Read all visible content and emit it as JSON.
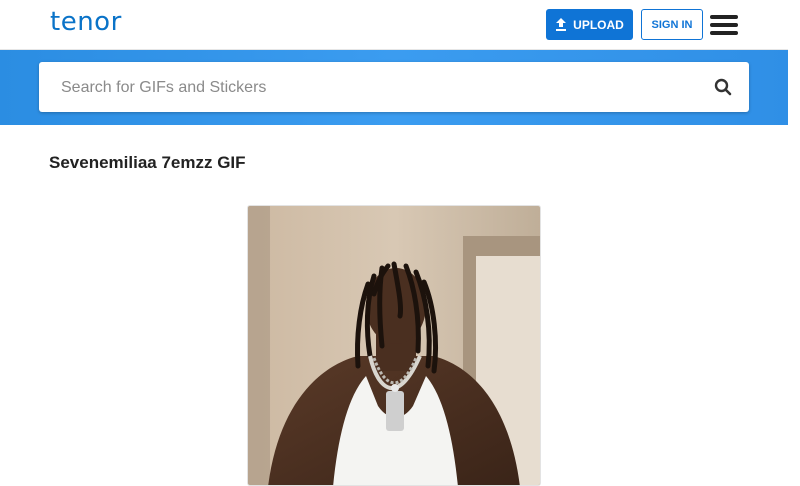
{
  "header": {
    "logo_text": "tenor",
    "upload_label": "UPLOAD",
    "signin_label": "SIGN IN",
    "menu_icon": "hamburger-menu-icon",
    "brand_color": "#0a73c8",
    "accent_color": "#0f74d6"
  },
  "search": {
    "placeholder": "Search for GIFs and Stickers",
    "value": "",
    "icon": "search-icon",
    "band_color": "#3b9cf0"
  },
  "main": {
    "title": "Sevenemiliaa 7emzz GIF"
  }
}
